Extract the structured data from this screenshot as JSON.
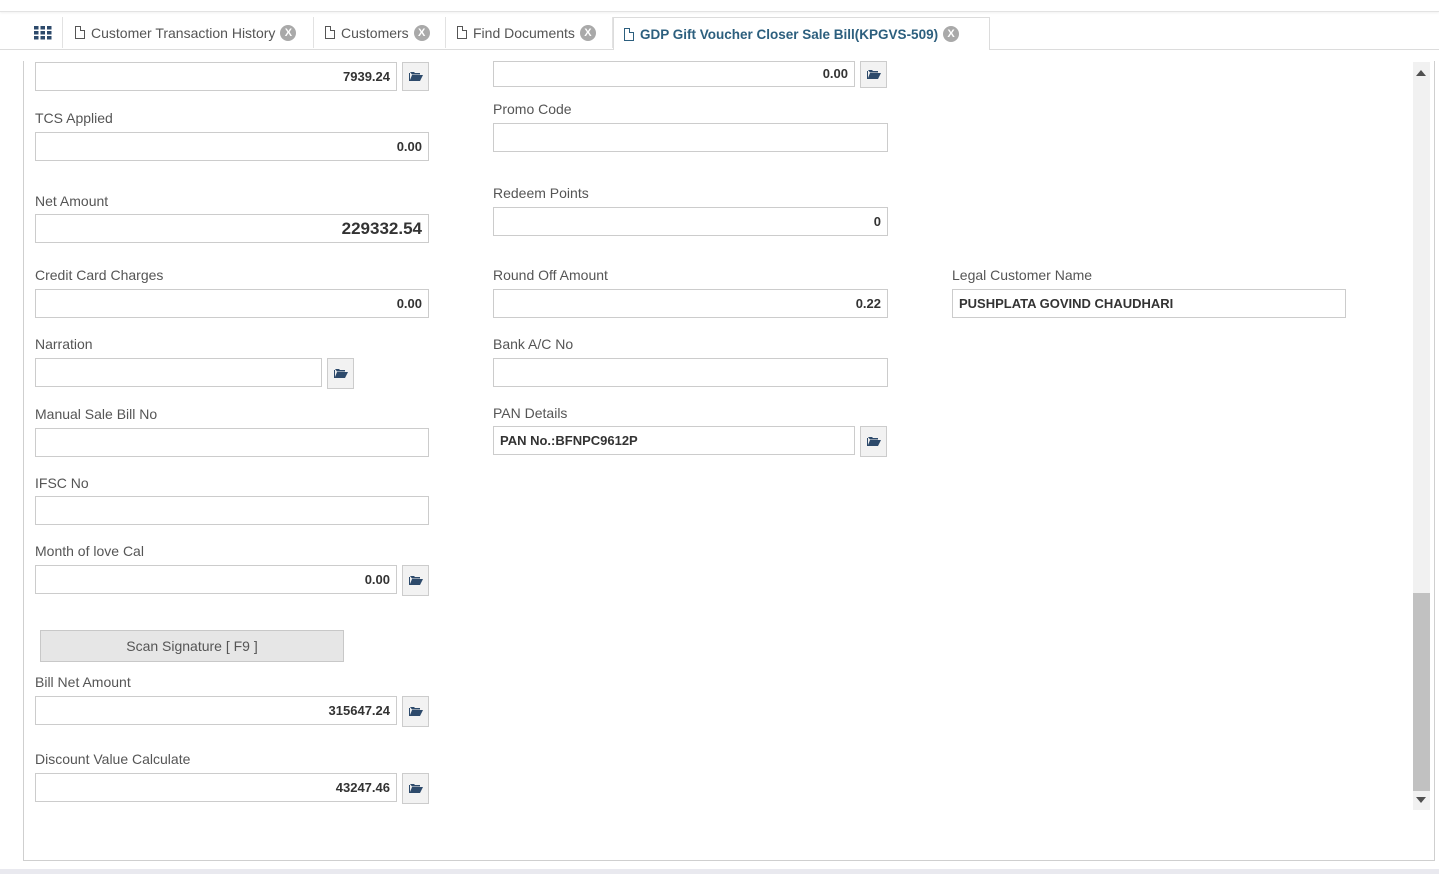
{
  "tabs": [
    {
      "label": "Customer Transaction History"
    },
    {
      "label": "Customers"
    },
    {
      "label": "Find Documents"
    },
    {
      "label": "GDP Gift Voucher Closer Sale Bill(KPGVS-509)"
    }
  ],
  "tab_close_glyph": "X",
  "form": {
    "top_left_value": "7939.24",
    "top_mid_value": "0.00",
    "tcs_applied": {
      "label": "TCS Applied",
      "value": "0.00"
    },
    "promo_code": {
      "label": "Promo Code",
      "value": ""
    },
    "net_amount": {
      "label": "Net Amount",
      "value": "229332.54"
    },
    "redeem_points": {
      "label": "Redeem Points",
      "value": "0"
    },
    "credit_card_charges": {
      "label": "Credit Card Charges",
      "value": "0.00"
    },
    "round_off_amount": {
      "label": "Round Off Amount",
      "value": "0.22"
    },
    "legal_customer_name": {
      "label": "Legal Customer Name",
      "value": "PUSHPLATA GOVIND CHAUDHARI"
    },
    "narration": {
      "label": "Narration",
      "value": ""
    },
    "bank_ac_no": {
      "label": "Bank A/C No",
      "value": ""
    },
    "manual_sale_bill_no": {
      "label": "Manual Sale Bill No",
      "value": ""
    },
    "pan_details": {
      "label": "PAN Details",
      "value": "PAN No.:BFNPC9612P"
    },
    "ifsc_no": {
      "label": "IFSC No",
      "value": ""
    },
    "month_of_love_cal": {
      "label": "Month of love Cal",
      "value": "0.00"
    },
    "scan_signature": {
      "label": "Scan Signature [ F9 ]"
    },
    "bill_net_amount": {
      "label": "Bill Net Amount",
      "value": "315647.24"
    },
    "discount_value_calculate": {
      "label": "Discount Value Calculate",
      "value": "43247.46"
    }
  },
  "icons": {
    "apps": "grid-icon",
    "tab": "document-icon",
    "close": "close-icon",
    "lookup": "folder-open-icon"
  },
  "colors": {
    "active_tab_text": "#2c5f7e",
    "border": "#cccccc",
    "label": "#555555"
  }
}
